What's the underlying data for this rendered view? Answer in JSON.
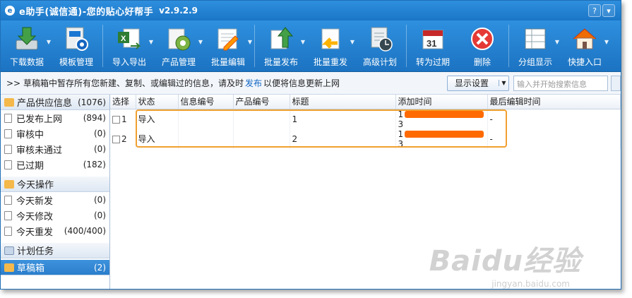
{
  "window": {
    "title": "e助手(诚信通)-您的贴心好帮手",
    "version": "v2.9.2.9",
    "help_icon": "?",
    "menu_icon": "▾"
  },
  "toolbar": [
    {
      "label": "下载数据",
      "icon": "download-icon",
      "color": "#4caf50"
    },
    {
      "label": "模板管理",
      "icon": "template-gear-icon",
      "color": "#e0e8f0"
    },
    {
      "label": "导入导出",
      "icon": "excel-icon",
      "color": "#2e7d32"
    },
    {
      "label": "产品管理",
      "icon": "product-gear-icon",
      "color": "#8bc34a"
    },
    {
      "label": "批量编辑",
      "icon": "edit-icon",
      "color": "#f5f5f5"
    },
    {
      "label": "批量发布",
      "icon": "upload-icon",
      "color": "#4caf50"
    },
    {
      "label": "批量重发",
      "icon": "republish-icon",
      "color": "#ffc107"
    },
    {
      "label": "高级计划",
      "icon": "clock-icon",
      "color": "#cfd8dc"
    },
    {
      "label": "转为过期",
      "icon": "calendar-icon",
      "color": "#ffffff"
    },
    {
      "label": "删除",
      "icon": "delete-icon",
      "color": "#e53935"
    },
    {
      "label": "分组显示",
      "icon": "grid-icon",
      "color": "#ffffff"
    },
    {
      "label": "快捷入口",
      "icon": "house-icon",
      "color": "#ff9800"
    }
  ],
  "notice": {
    "text_before": "草稿箱中暂存所有您新建、复制、或编辑过的信息，请及时",
    "link": "发布",
    "text_after": "以便将信息更新上网",
    "display_settings": "显示设置",
    "search_placeholder": "输入并开始搜索信息"
  },
  "sidebar": {
    "groups": [
      {
        "label": "产品供应信息",
        "count": "(1076)",
        "items": [
          {
            "label": "已发布上网",
            "count": "(894)"
          },
          {
            "label": "审核中",
            "count": "(0)"
          },
          {
            "label": "审核未通过",
            "count": "(0)"
          },
          {
            "label": "已过期",
            "count": "(182)"
          }
        ]
      },
      {
        "label": "今天操作",
        "items": [
          {
            "label": "今天新发",
            "count": "(0)"
          },
          {
            "label": "今天修改",
            "count": "(0)"
          },
          {
            "label": "今天重发",
            "count": "(400/400)"
          }
        ]
      },
      {
        "label": "计划任务"
      },
      {
        "label": "草稿箱",
        "count": "(2)"
      }
    ]
  },
  "table": {
    "columns": [
      "选择",
      "状态",
      "信息编号",
      "产品编号",
      "标题",
      "添加时间",
      "最后编辑时间"
    ],
    "rows": [
      {
        "index": "1",
        "status": "导入",
        "title": "1",
        "added_prefix": "1",
        "added_suffix": "3",
        "last_edit": "-"
      },
      {
        "index": "2",
        "status": "导入",
        "title": "2",
        "added_prefix": "1",
        "added_suffix": "3",
        "last_edit": "-"
      }
    ]
  },
  "watermark": {
    "text": "Baidu经验",
    "sub": "jingyan.baidu.com"
  }
}
